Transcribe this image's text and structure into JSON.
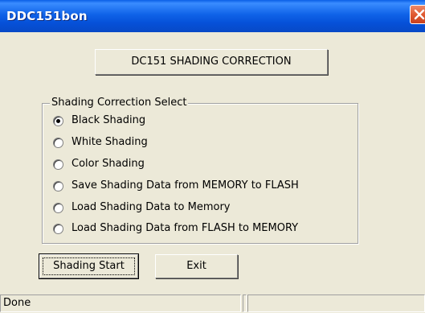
{
  "window": {
    "title": "DDC151bon",
    "close_icon": "close-icon",
    "titlebar_color": "#0a5fe6"
  },
  "header": {
    "label": "DC151 SHADING CORRECTION"
  },
  "shading_select": {
    "legend": "Shading Correction Select",
    "options": [
      {
        "label": "Black Shading",
        "checked": true
      },
      {
        "label": "White Shading",
        "checked": false
      },
      {
        "label": "Color Shading",
        "checked": false
      },
      {
        "label": "Save Shading Data from MEMORY to FLASH",
        "checked": false
      },
      {
        "label": "Load Shading Data to Memory",
        "checked": false
      },
      {
        "label": "Load Shading Data from FLASH to MEMORY",
        "checked": false
      }
    ]
  },
  "buttons": {
    "start_label": "Shading Start",
    "exit_label": "Exit"
  },
  "status": {
    "text": "Done",
    "pane2": "",
    "pane3": ""
  }
}
